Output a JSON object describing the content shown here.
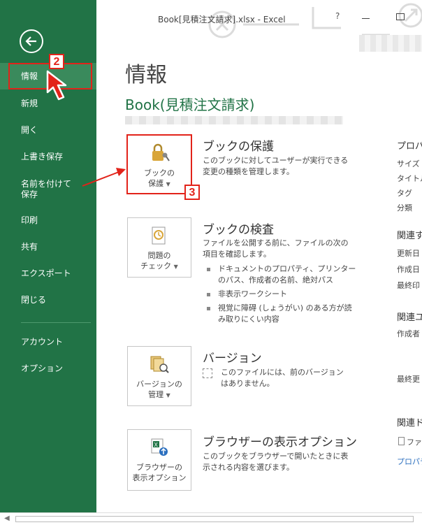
{
  "window": {
    "title": "Book[見積注文請求].xlsx - Excel",
    "help": "?"
  },
  "sidebar": {
    "items": [
      {
        "label": "情報"
      },
      {
        "label": "新規"
      },
      {
        "label": "開く"
      },
      {
        "label": "上書き保存"
      },
      {
        "label": "名前を付けて\n保存"
      },
      {
        "label": "印刷"
      },
      {
        "label": "共有"
      },
      {
        "label": "エクスポート"
      },
      {
        "label": "閉じる"
      },
      {
        "label": "アカウント"
      },
      {
        "label": "オプション"
      }
    ]
  },
  "main": {
    "page_title": "情報",
    "file_name": "Book(見積注文請求)",
    "sections": {
      "protect": {
        "tile_line1": "ブックの",
        "tile_line2": "保護",
        "title": "ブックの保護",
        "desc": "このブックに対してユーザーが実行できる変更の種類を管理します。"
      },
      "inspect": {
        "tile_line1": "問題の",
        "tile_line2": "チェック",
        "title": "ブックの検査",
        "desc": "ファイルを公開する前に、ファイルの次の項目を確認します。",
        "bullets": [
          "ドキュメントのプロパティ、プリンターのパス、作成者の名前、絶対パス",
          "非表示ワークシート",
          "視覚に障碍 (しょうがい) のある方が読み取りにくい内容"
        ]
      },
      "versions": {
        "tile_line1": "バージョンの",
        "tile_line2": "管理",
        "title": "バージョン",
        "note": "このファイルには、前のバージョンはありません。"
      },
      "browser": {
        "tile_line1": "ブラウザーの",
        "tile_line2": "表示オプション",
        "title": "ブラウザーの表示オプション",
        "desc": "このブックをブラウザーで開いたときに表示される内容を選びます。"
      }
    }
  },
  "properties": {
    "header": "プロパ",
    "fields": [
      "サイズ",
      "タイトル",
      "タグ",
      "分類"
    ],
    "dates_header": "関連す",
    "dates": [
      "更新日",
      "作成日",
      "最終印"
    ],
    "people_header": "関連ユ",
    "people": [
      "作成者",
      "最終更"
    ],
    "docs_header": "関連ド",
    "doc_item": "ファ",
    "link": "プロパテ"
  },
  "annotations": {
    "step2": "2",
    "step3": "3"
  },
  "colors": {
    "sidebar_bg": "#217346",
    "accent_green": "#217346",
    "annotation_red": "#e2231a"
  }
}
